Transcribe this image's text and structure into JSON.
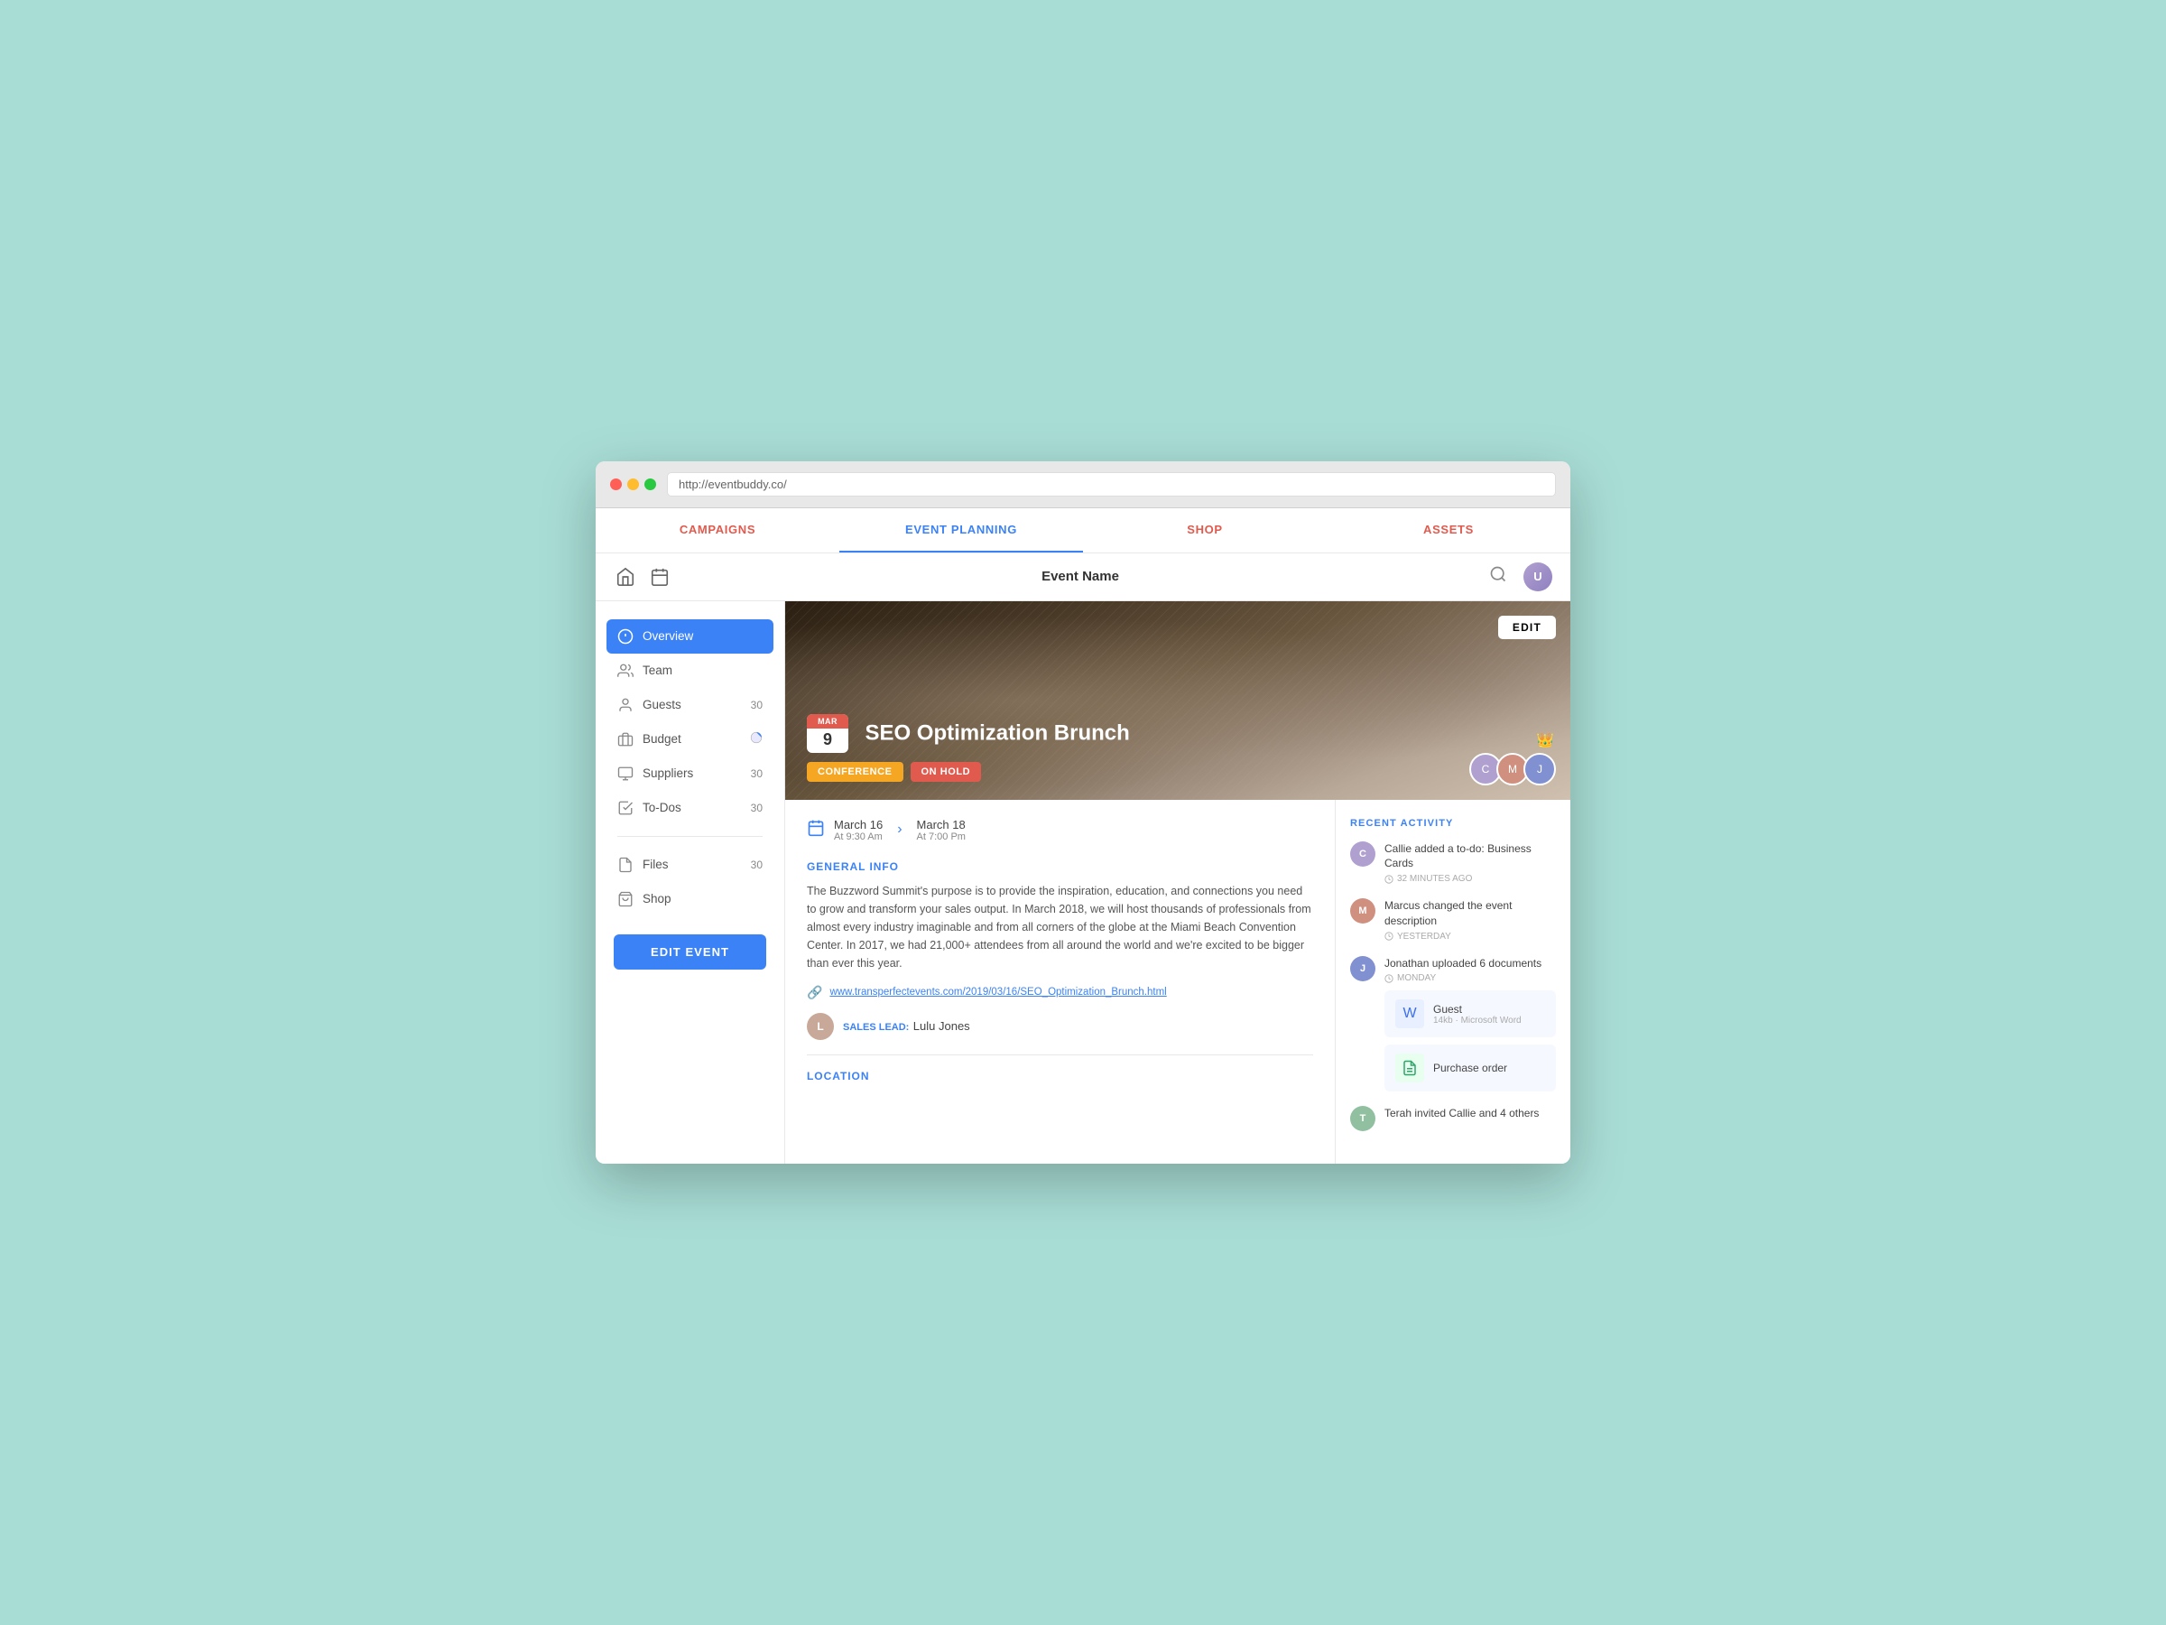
{
  "browser": {
    "url": "http://eventbuddy.co/"
  },
  "topnav": {
    "items": [
      {
        "id": "campaigns",
        "label": "CAMPAIGNS",
        "active": false
      },
      {
        "id": "event-planning",
        "label": "EVENT PLANNING",
        "active": true
      },
      {
        "id": "shop",
        "label": "SHOP",
        "active": false
      },
      {
        "id": "assets",
        "label": "ASSETS",
        "active": false
      }
    ]
  },
  "toolbar": {
    "event_name": "Event Name"
  },
  "sidebar": {
    "items": [
      {
        "id": "overview",
        "label": "Overview",
        "icon": "info",
        "badge": "",
        "active": true
      },
      {
        "id": "team",
        "label": "Team",
        "icon": "team",
        "badge": "",
        "active": false
      },
      {
        "id": "guests",
        "label": "Guests",
        "icon": "guests",
        "badge": "30",
        "active": false
      },
      {
        "id": "budget",
        "label": "Budget",
        "icon": "budget",
        "badge": "",
        "active": false
      },
      {
        "id": "suppliers",
        "label": "Suppliers",
        "icon": "suppliers",
        "badge": "30",
        "active": false
      },
      {
        "id": "todos",
        "label": "To-Dos",
        "icon": "todos",
        "badge": "30",
        "active": false
      },
      {
        "id": "files",
        "label": "Files",
        "icon": "files",
        "badge": "30",
        "active": false
      },
      {
        "id": "shop",
        "label": "Shop",
        "icon": "shop",
        "badge": "",
        "active": false
      }
    ],
    "edit_event_label": "EDIT EVENT"
  },
  "hero": {
    "edit_button": "EDIT",
    "date": {
      "month": "MAR",
      "day": "9"
    },
    "title": "SEO Optimization Brunch",
    "tags": [
      {
        "label": "CONFERENCE",
        "type": "conference"
      },
      {
        "label": "ON HOLD",
        "type": "on-hold"
      }
    ],
    "avatars": [
      {
        "initials": "C",
        "color": "#b0a0d0"
      },
      {
        "initials": "M",
        "color": "#d09080"
      },
      {
        "initials": "J",
        "color": "#8090d0"
      }
    ]
  },
  "overview": {
    "start_date": "March 16",
    "start_time": "At 9:30 Am",
    "end_date": "March 18",
    "end_time": "At 7:00 Pm",
    "general_info_title": "GENERAL INFO",
    "description": "The Buzzword Summit's purpose is to provide the inspiration, education, and connections you need to grow and transform your sales output. In March 2018, we will host thousands of professionals from almost every industry imaginable and from all corners of the globe at the Miami Beach Convention Center. In 2017, we had 21,000+ attendees from all around the world and we're excited to be bigger than ever this year.",
    "event_url": "www.transperfectevents.com/2019/03/16/SEO_Optimization_Brunch.html",
    "sales_lead_label": "SALES LEAD:",
    "sales_lead_name": "Lulu Jones",
    "location_title": "LOCATION"
  },
  "recent_activity": {
    "title": "RECENT ACTIVITY",
    "items": [
      {
        "id": "activity-1",
        "avatar_initials": "C",
        "avatar_color": "#b0a0d0",
        "text": "Callie added a to-do: Business Cards",
        "time": "32 MINUTES AGO",
        "files": []
      },
      {
        "id": "activity-2",
        "avatar_initials": "M",
        "avatar_color": "#d09080",
        "text": "Marcus changed the event description",
        "time": "YESTERDAY",
        "files": []
      },
      {
        "id": "activity-3",
        "avatar_initials": "J",
        "avatar_color": "#8090d0",
        "text": "Jonathan uploaded 6 documents",
        "time": "MONDAY",
        "files": [
          {
            "name": "Guest",
            "meta": "14kb · Microsoft Word",
            "type": "word"
          },
          {
            "name": "Purchase order",
            "meta": "",
            "type": "sheet"
          }
        ]
      },
      {
        "id": "activity-4",
        "avatar_initials": "T",
        "avatar_color": "#90c0a0",
        "text": "Terah invited Callie and 4 others",
        "time": "",
        "files": []
      }
    ]
  }
}
